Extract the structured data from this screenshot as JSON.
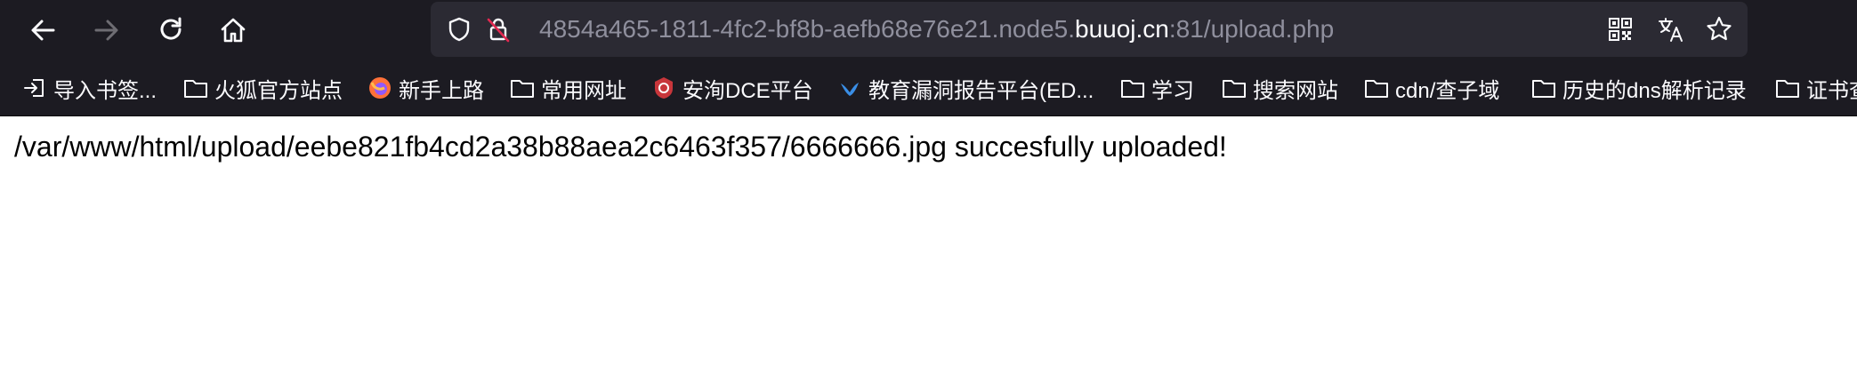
{
  "colors": {
    "toolbar_bg": "#1c1b22",
    "urlbar_bg": "#2b2a33",
    "url_dim": "#8f8f9d",
    "url_host": "#fbfbfe",
    "page_bg": "#ffffff"
  },
  "nav": {
    "back_icon": "arrow-left-icon",
    "forward_icon": "arrow-right-icon",
    "reload_icon": "reload-icon",
    "home_icon": "home-icon"
  },
  "urlbar": {
    "subdomain": "4854a465-1811-4fc2-bf8b-aefb68e76e21.node5.",
    "host": "buuoj.cn",
    "path": ":81/upload.php",
    "icons": [
      "shield-icon",
      "insecure-lock-icon"
    ],
    "actions": [
      "qr-code-icon",
      "translate-icon",
      "star-icon"
    ]
  },
  "bookmarks": [
    {
      "label": "导入书签...",
      "icon": "import-icon"
    },
    {
      "label": "火狐官方站点",
      "icon": "folder-icon"
    },
    {
      "label": "新手上路",
      "icon": "firefox-icon"
    },
    {
      "label": "常用网址",
      "icon": "folder-icon"
    },
    {
      "label": "安洵DCE平台",
      "icon": "badge-icon"
    },
    {
      "label": "教育漏洞报告平台(ED...",
      "icon": "bird-icon"
    },
    {
      "label": "学习",
      "icon": "folder-icon"
    },
    {
      "label": "搜索网站",
      "icon": "folder-icon"
    },
    {
      "label": "cdn/查子域",
      "icon": "folder-icon"
    },
    {
      "label": "历史的dns解析记录",
      "icon": "folder-icon"
    },
    {
      "label": "证书查",
      "icon": "folder-icon"
    }
  ],
  "page": {
    "message": "/var/www/html/upload/eebe821fb4cd2a38b88aea2c6463f357/6666666.jpg succesfully uploaded!"
  }
}
